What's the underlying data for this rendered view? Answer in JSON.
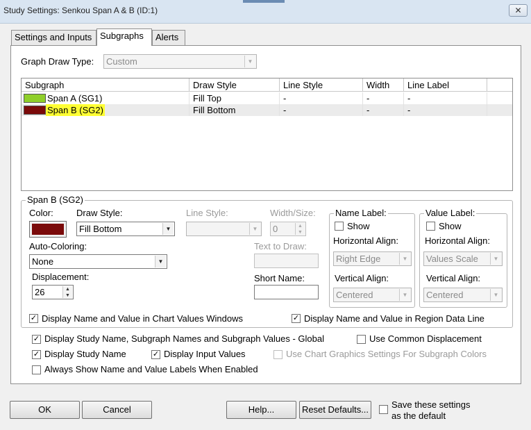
{
  "window": {
    "title": "Study Settings: Senkou Span A & B (ID:1)",
    "close_glyph": "✕"
  },
  "tabs": [
    {
      "label": "Settings and Inputs"
    },
    {
      "label": "Subgraphs",
      "active": true
    },
    {
      "label": "Alerts"
    }
  ],
  "graph_draw_type": {
    "label": "Graph Draw Type:",
    "value": "Custom"
  },
  "grid": {
    "columns": [
      "Subgraph",
      "Draw Style",
      "Line Style",
      "Width",
      "Line Label"
    ],
    "rows": [
      {
        "name": "Span A (SG1)",
        "color": "#8fcf2a",
        "draw_style": "Fill Top",
        "line_style": "-",
        "width": "-",
        "line_label": "-"
      },
      {
        "name": "Span B (SG2)",
        "color": "#7a0a0a",
        "draw_style": "Fill Bottom",
        "line_style": "-",
        "width": "-",
        "line_label": "-",
        "selected": true
      }
    ]
  },
  "detail": {
    "group_title": "Span B (SG2)",
    "color_label": "Color:",
    "color_value": "#7a0a0a",
    "draw_style_label": "Draw Style:",
    "draw_style_value": "Fill Bottom",
    "line_style_label": "Line Style:",
    "line_style_value": "",
    "width_label": "Width/Size:",
    "width_value": "0",
    "auto_coloring_label": "Auto-Coloring:",
    "auto_coloring_value": "None",
    "text_to_draw_label": "Text to Draw:",
    "displacement_label": "Displacement:",
    "displacement_value": "26",
    "short_name_label": "Short Name:",
    "short_name_value": "",
    "name_label": {
      "title": "Name Label:",
      "show": "Show",
      "h_align_label": "Horizontal Align:",
      "h_align_value": "Right Edge",
      "v_align_label": "Vertical Align:",
      "v_align_value": "Centered"
    },
    "value_label": {
      "title": "Value Label:",
      "show": "Show",
      "h_align_label": "Horizontal Align:",
      "h_align_value": "Values Scale",
      "v_align_label": "Vertical Align:",
      "v_align_value": "Centered"
    },
    "display_chart_values": "Display Name and Value in Chart Values Windows",
    "display_region_data": "Display Name and Value in Region Data Line"
  },
  "options": {
    "global": "Display Study Name, Subgraph Names and Subgraph Values - Global",
    "common_displacement": "Use Common Displacement",
    "study_name": "Display Study Name",
    "input_values": "Display Input Values",
    "chart_graphics": "Use Chart Graphics Settings For Subgraph Colors",
    "always_show": "Always Show Name and Value Labels When Enabled"
  },
  "buttons": {
    "ok": "OK",
    "cancel": "Cancel",
    "help": "Help...",
    "reset": "Reset Defaults...",
    "save_default_line1": "Save these settings",
    "save_default_line2": "as the default"
  },
  "glyphs": {
    "check": "✓",
    "down": "▼",
    "up": "▲"
  },
  "colors": {
    "selected_highlight": "#ffff33",
    "row_selected_bg": "#ebebeb"
  }
}
